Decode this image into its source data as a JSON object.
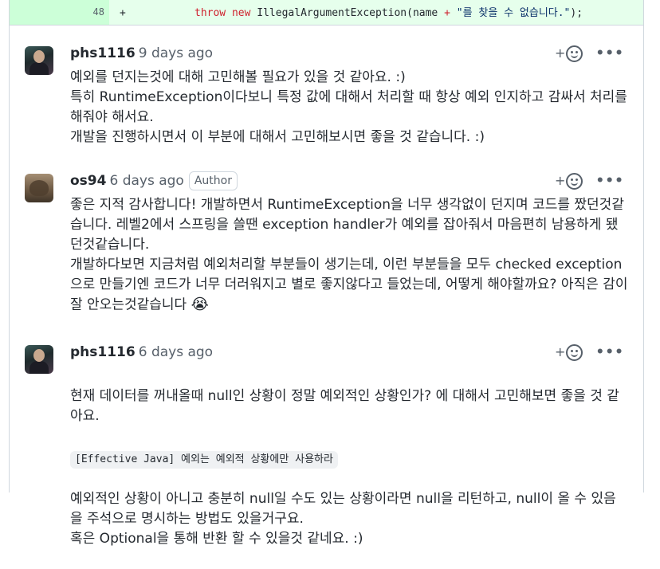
{
  "diff": {
    "line_number": "48",
    "sign": "+",
    "code_kw1": "throw",
    "code_kw2": "new",
    "code_plain1": " IllegalArgumentException(name ",
    "code_op": "+",
    "code_string": " \"를 찾을 수 없습니다.\"",
    "code_end": ");"
  },
  "comments": [
    {
      "author": "phs1116",
      "time": "9 days ago",
      "badge": "",
      "body": "예외를 던지는것에 대해 고민해볼 필요가 있을 것 같아요. :)\n특히 RuntimeException이다보니 특정 값에 대해서 처리할 때 항상 예외 인지하고 감싸서 처리를 해줘야 해서요.\n개발을 진행하시면서 이 부분에 대해서 고민해보시면 좋을 것 같습니다. :)"
    },
    {
      "author": "os94",
      "time": "6 days ago",
      "badge": "Author",
      "body": "좋은 지적 감사합니다! 개발하면서 RuntimeException을 너무 생각없이 던지며 코드를 짰던것같습니다. 레벨2에서 스프링을 쓸땐 exception handler가 예외를 잡아줘서 마음편히 남용하게 됐던것같습니다.\n개발하다보면 지금처럼 예외처리할 부분들이 생기는데, 이런 부분들을 모두 checked exception으로 만들기엔 코드가 너무 더러워지고 별로 좋지않다고 들었는데, 어떻게 해야할까요? 아직은 감이 잘 안오는것같습니다",
      "emoji": "😭"
    },
    {
      "author": "phs1116",
      "time": "6 days ago",
      "badge": "",
      "body_1": "현재 데이터를 꺼내올때 null인 상황이 정말 예외적인 상황인가? 에 대해서 고민해보면 좋을 것 같아요.",
      "code": "[Effective Java] 예외는 예외적 상황에만 사용하라",
      "body_2": "예외적인 상황이 아니고 충분히 null일 수도 있는 상황이라면 null을 리턴하고, null이 올 수 있음을 주석으로 명시하는 방법도 있을거구요.\n혹은 Optional을 통해 반환 할 수 있을것 같네요. :)"
    }
  ],
  "actions": {
    "add_reaction": "+",
    "more": "•••"
  }
}
